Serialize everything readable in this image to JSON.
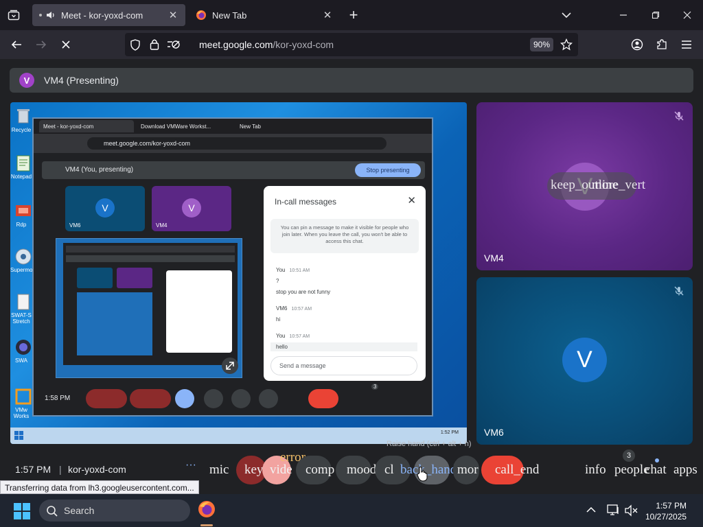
{
  "browser": {
    "tabs": [
      {
        "title": "Meet - kor-yoxd-com",
        "active": true
      },
      {
        "title": "New Tab",
        "active": false
      }
    ],
    "url_host": "meet.google.com",
    "url_path": "/kor-yoxd-com",
    "zoom": "90%",
    "status_text": "Transferring data from lh3.googleusercontent.com..."
  },
  "meet": {
    "presenter_initial": "V",
    "presenting_label": "VM4 (Presenting)",
    "time": "1:57 PM",
    "separator": "|",
    "meeting_code": "kor-yoxd-com",
    "tiles": [
      {
        "name": "VM4",
        "initial": "V",
        "hover_text": "keep_outline",
        "hover_text2": "more_vert",
        "muted": true
      },
      {
        "name": "VM6",
        "initial": "V",
        "muted": true
      }
    ],
    "controls": {
      "more_glyph": "···",
      "mic": "mic",
      "keyboard": "keyb",
      "video": "vide",
      "video_error": "error",
      "compose": "comp",
      "mood": "mood",
      "closed_caption": "cl",
      "hand_back": "back_hand",
      "more": "mor",
      "call_end": "call_end",
      "info": "info",
      "people": "people",
      "people_count": "3",
      "chat": "chat",
      "apps": "apps",
      "raise_hand_tooltip": "Raise hand (ctrl + alt + h)"
    },
    "shared_screen": {
      "tabs": [
        "Meet - kor-yoxd-com",
        "Download VMWare Workst...",
        "New Tab"
      ],
      "url": "meet.google.com/kor-yoxd-com",
      "presenting_text": "VM4 (You, presenting)",
      "stop_presenting": "Stop presenting",
      "mini_tiles": [
        {
          "name": "VM6",
          "initial": "V"
        },
        {
          "name": "VM4",
          "initial": "V"
        }
      ],
      "chat": {
        "title": "In-call messages",
        "note": "You can pin a message to make it visible for people who join later. When you leave the call, you won't be able to access this chat.",
        "messages": [
          {
            "sender": "You",
            "time": "10:51 AM",
            "lines": [
              "?",
              "stop you are not funny"
            ]
          },
          {
            "sender": "VM6",
            "time": "10:57 AM",
            "lines": [
              "hi"
            ]
          },
          {
            "sender": "You",
            "time": "10:57 AM",
            "lines": [
              "hello"
            ]
          }
        ],
        "input_placeholder": "Send a message"
      },
      "call_time": "1:58 PM",
      "people_count": "3",
      "taskbar_time": "1:52 PM",
      "desktop_icons": [
        "Recycle",
        "Notepad",
        "Rdp",
        "Supermo",
        "SWAT-S Stretch",
        "SWA",
        "VMw Works"
      ]
    }
  },
  "taskbar": {
    "search_label": "Search",
    "time": "1:57 PM",
    "date": "10/27/2025"
  },
  "colors": {
    "accent_red": "#ea4335",
    "tile_purple": "#5b2785",
    "tile_blue": "#0a4e78",
    "chat_blue": "#8ab4f8"
  }
}
